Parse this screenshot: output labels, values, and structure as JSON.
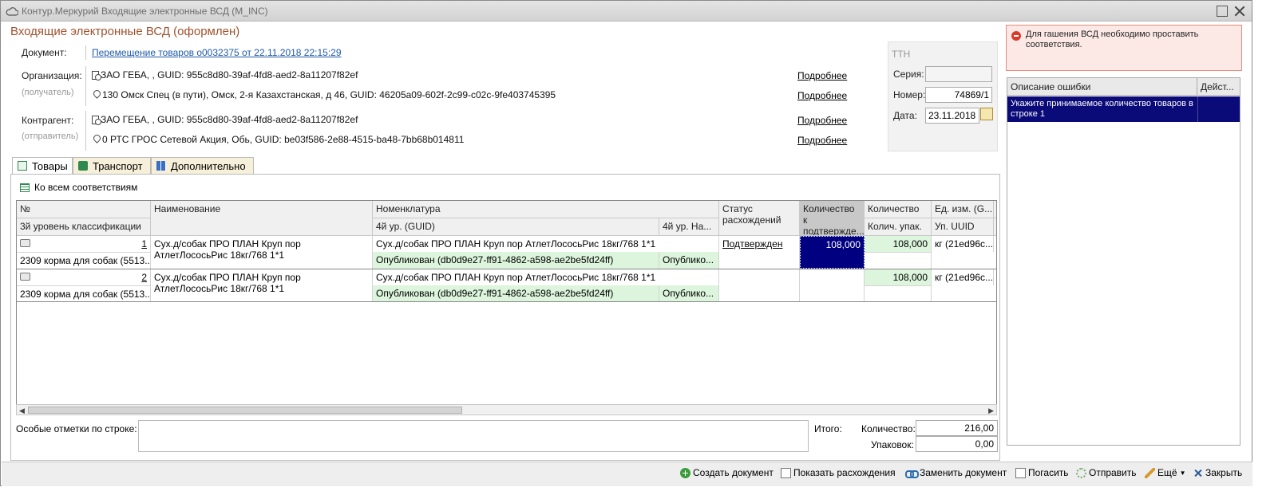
{
  "window": {
    "title": "Контур.Меркурий Входящие электронные ВСД (M_INC)"
  },
  "doc_title": "Входящие электронные ВСД (оформлен)",
  "document": {
    "label": "Документ:",
    "link": "Перемещение товаров о0032375 от 22.11.2018 22:15:29"
  },
  "organization": {
    "label": "Организация:",
    "sublabel": "(получатель)",
    "company": "ЗАО ГЕБА, , GUID: 955c8d80-39af-4fd8-aed2-8a11207f82ef",
    "address": "130 Омск Спец (в пути), Омск, 2-я Казахстанская, д 46, GUID: 46205a09-602f-2c99-c02c-9fe403745395",
    "more1": "Подробнее",
    "more2": "Подробнее"
  },
  "counterparty": {
    "label": "Контрагент:",
    "sublabel": "(отправитель)",
    "company": "ЗАО ГЕБА, , GUID: 955c8d80-39af-4fd8-aed2-8a11207f82ef",
    "address": "0 РТС ГРОС Сетевой Акция, Обь, GUID: be03f586-2e88-4515-ba48-7bb68b014811",
    "more1": "Подробнее",
    "more2": "Подробнее"
  },
  "ttn": {
    "title": "ТТН",
    "series_label": "Серия:",
    "series_value": "",
    "number_label": "Номер:",
    "number_value": "74869/1",
    "date_label": "Дата:",
    "date_value": "23.11.2018"
  },
  "error_banner": {
    "text": "Для гашения ВСД необходимо проставить соответствия."
  },
  "error_grid": {
    "col1": "Описание ошибки",
    "col2": "Дейст...",
    "rows": [
      {
        "description": "Укажите принимаемое количество товаров в строке 1",
        "action": ""
      }
    ]
  },
  "tabs": [
    {
      "label": "Товары"
    },
    {
      "label": "Транспорт"
    },
    {
      "label": "Дополнительно"
    }
  ],
  "toolbar": {
    "match_all": "Ко всем соответствиям"
  },
  "grid": {
    "headers": {
      "num": "№",
      "class3": "3й уровень классификации",
      "name": "Наименование",
      "nomenclature": "Номенклатура",
      "guid4": "4й ур. (GUID)",
      "name4": "4й ур. На...",
      "status": "Статус расхождений",
      "qty_confirm": "Количество к подтвержде...",
      "qty": "Количество",
      "qty_pack": "Колич. упак.",
      "unit": "Ед. изм. (G...",
      "pack_uuid": "Уп. UUID"
    },
    "rows": [
      {
        "num": "1",
        "class3": "2309 корма для собак (5513...",
        "name": "Сух.д/собак ПРО ПЛАН Круп пор АтлетЛососьРис 18кг/768 1*1",
        "nomenclature": "Сух.д/собак ПРО ПЛАН Круп пор АтлетЛососьРис 18кг/768 1*1",
        "guid4": "Опубликован (db0d9e27-ff91-4862-a598-ae2be5fd24ff)",
        "name4": "Опублико...",
        "status": "Подтвержден",
        "qty_confirm": "108,000",
        "qty": "108,000",
        "unit": "кг (21ed96c..."
      },
      {
        "num": "2",
        "class3": "2309 корма для собак (5513...",
        "name": "Сух.д/собак ПРО ПЛАН Круп пор АтлетЛососьРис 18кг/768 1*1",
        "nomenclature": "Сух.д/собак ПРО ПЛАН Круп пор АтлетЛососьРис 18кг/768 1*1",
        "guid4": "Опубликован (db0d9e27-ff91-4862-a598-ae2be5fd24ff)",
        "name4": "Опублико...",
        "status": "",
        "qty_confirm": "",
        "qty": "108,000",
        "unit": "кг (21ed96c..."
      }
    ]
  },
  "notes": {
    "label": "Особые отметки по строке:",
    "value": ""
  },
  "totals": {
    "label": "Итого:",
    "qty_label": "Количество:",
    "qty_value": "216,00",
    "pack_label": "Упаковок:",
    "pack_value": "0,00"
  },
  "actions": {
    "create": "Создать документ",
    "show_diff": "Показать расхождения",
    "replace": "Заменить документ",
    "redeem": "Погасить",
    "send": "Отправить",
    "more": "Ещё",
    "close": "Закрыть"
  }
}
